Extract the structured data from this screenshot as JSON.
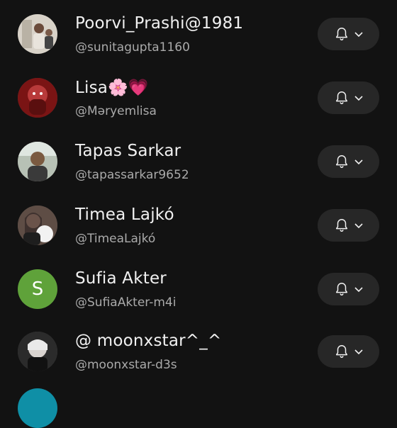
{
  "subscriptions": [
    {
      "name": "Poorvi_Prashi@1981",
      "handle": "@sunitagupta1160",
      "avatar": "photo",
      "avatar_color": "#c9c2b8"
    },
    {
      "name": "Lisa🌸💗",
      "handle": "@Məryemlisa",
      "avatar": "photo",
      "avatar_color": "#8a1c1c"
    },
    {
      "name": "Tapas Sarkar",
      "handle": "@tapassarkar9652",
      "avatar": "photo",
      "avatar_color": "#9aa39a"
    },
    {
      "name": "Timea Lajkó",
      "handle": "@TimeaLajkó",
      "avatar": "photo",
      "avatar_color": "#6e5a52"
    },
    {
      "name": "Sufia Akter",
      "handle": "@SufiaAkter-m4i",
      "avatar": "letter",
      "avatar_letter": "S",
      "avatar_color": "#5fa23a"
    },
    {
      "name": "@ moonxstar^_^",
      "handle": "@moonxstar-d3s",
      "avatar": "photo",
      "avatar_color": "#3a3a3a"
    }
  ],
  "notification_button": {
    "icon": "bell-icon",
    "dropdown_icon": "chevron-down-icon"
  },
  "colors": {
    "background": "#121212",
    "button_bg": "#272727",
    "secondary_text": "#aaaaaa"
  }
}
